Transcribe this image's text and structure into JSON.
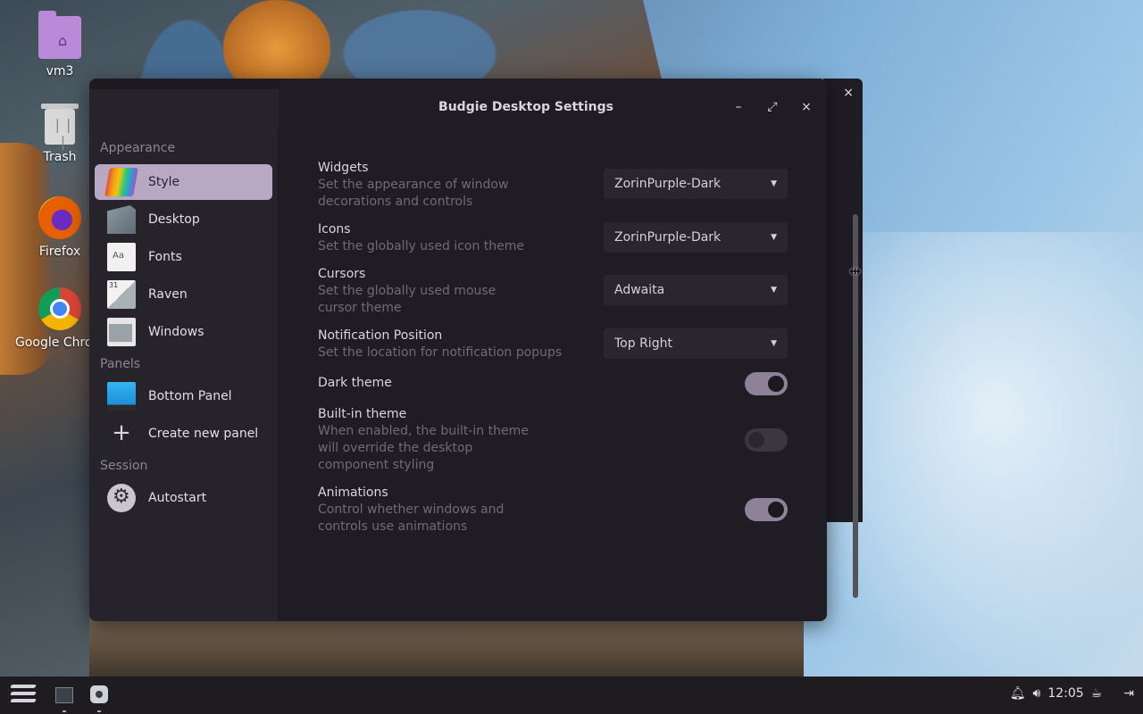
{
  "desktop": {
    "icons": [
      {
        "label": "vm3",
        "icon": "home-folder-icon"
      },
      {
        "label": "Trash",
        "icon": "trash-icon"
      },
      {
        "label": "Firefox",
        "icon": "firefox-icon"
      },
      {
        "label": "Google Chrom",
        "icon": "chrome-icon"
      }
    ]
  },
  "back_window": {
    "close": "×"
  },
  "window": {
    "title": "Budgie Desktop Settings",
    "minimize": "–",
    "maximize": "⤢",
    "close": "×"
  },
  "sidebar": {
    "sections": [
      {
        "title": "Appearance",
        "items": [
          {
            "label": "Style",
            "icon": "style-icon",
            "active": true
          },
          {
            "label": "Desktop",
            "icon": "desktop-icon"
          },
          {
            "label": "Fonts",
            "icon": "fonts-icon"
          },
          {
            "label": "Raven",
            "icon": "raven-icon"
          },
          {
            "label": "Windows",
            "icon": "windows-icon"
          }
        ]
      },
      {
        "title": "Panels",
        "items": [
          {
            "label": "Bottom Panel",
            "icon": "panel-icon"
          },
          {
            "label": "Create new panel",
            "icon": "plus-icon"
          }
        ]
      },
      {
        "title": "Session",
        "items": [
          {
            "label": "Autostart",
            "icon": "gear-icon"
          }
        ]
      }
    ]
  },
  "settings": {
    "widgets": {
      "label": "Widgets",
      "desc": "Set the appearance of window decorations and controls",
      "value": "ZorinPurple-Dark"
    },
    "icons": {
      "label": "Icons",
      "desc": "Set the globally used icon theme",
      "value": "ZorinPurple-Dark"
    },
    "cursors": {
      "label": "Cursors",
      "desc": "Set the globally used mouse cursor theme",
      "value": "Adwaita"
    },
    "notification": {
      "label": "Notification Position",
      "desc": "Set the location for notification popups",
      "value": "Top Right"
    },
    "dark_theme": {
      "label": "Dark theme",
      "on": true
    },
    "builtin_theme": {
      "label": "Built-in theme",
      "desc": "When enabled, the built-in theme will override the desktop component styling",
      "on": false
    },
    "animations": {
      "label": "Animations",
      "desc": "Control whether windows and controls use animations",
      "on": true
    }
  },
  "taskbar": {
    "clock": "12:05",
    "tray_icons": [
      "bell-icon",
      "volume-icon",
      "coffee-icon",
      "logout-icon"
    ]
  },
  "colors": {
    "accent": "#b9a8c4",
    "window_bg": "#1f1d23",
    "sidebar_bg": "#26232b",
    "toggle_on": "#8e8298"
  }
}
